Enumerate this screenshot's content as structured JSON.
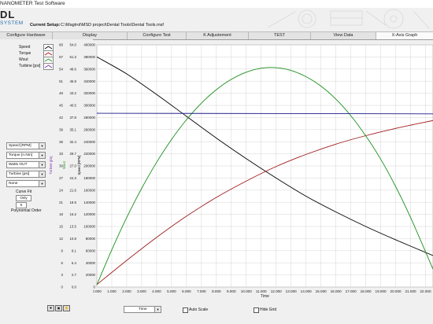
{
  "window": {
    "title": "NANOMETER Test Software"
  },
  "logo": {
    "mark": "DL",
    "subtitle": "SYSTEM"
  },
  "setup": {
    "label": "Current Setup:",
    "value": "C:\\Magtrol\\MSD project\\Dental Tools\\Dental Tools.msf"
  },
  "tabs": [
    {
      "label": "Configure Hardware"
    },
    {
      "label": "Display"
    },
    {
      "label": "Configure Test"
    },
    {
      "label": "K Adjustement"
    },
    {
      "label": "TEST"
    },
    {
      "label": "View Data"
    },
    {
      "label": "X-Axis Graph",
      "active": true
    }
  ],
  "legend": [
    {
      "label": "Speed",
      "color": "#000000"
    },
    {
      "label": "Torque",
      "color": "#c00000"
    },
    {
      "label": "Wout",
      "color": "#1a8f1a"
    },
    {
      "label": "Turbine [psi]",
      "color": "#7a2ca8"
    }
  ],
  "selectors": [
    {
      "value": "Speed [RPM]"
    },
    {
      "value": "Torque [n.Nm]"
    },
    {
      "value": "Watts OUT"
    },
    {
      "value": "Turbine [psi]"
    },
    {
      "value": "None"
    }
  ],
  "curve_fit": {
    "label": "Curve Fit",
    "mode": "Only",
    "order": "5",
    "order_label": "Polynomial Order"
  },
  "bottom": {
    "x_axis_select": "Time",
    "auto_scale_label": "Auto Scale",
    "hide_grid_label": "Hide Grid"
  },
  "chart_data": {
    "type": "line",
    "xlabel": "Time",
    "x_ticks": [
      "0.000",
      "1.000",
      "2.000",
      "3.000",
      "4.000",
      "5.000",
      "6.000",
      "7.000",
      "8.000",
      "9.000",
      "10.000",
      "11.000",
      "12.000",
      "13.000",
      "14.000",
      "15.000",
      "16.000",
      "17.000",
      "18.000",
      "19.000",
      "20.000",
      "21.000",
      "22.000"
    ],
    "xlim": [
      0,
      22.5
    ],
    "axes": [
      {
        "label": "Turbine [psi]",
        "color": "#7a2ca8",
        "ticks": [
          "0",
          "3",
          "6",
          "9",
          "12",
          "15",
          "18",
          "21",
          "24",
          "27",
          "30",
          "33",
          "36",
          "39",
          "42",
          "45",
          "48",
          "51",
          "54",
          "57",
          "60"
        ]
      },
      {
        "label": "Wout",
        "color": "#1a8f1a",
        "ticks": [
          "0.0",
          "2.7",
          "5.4",
          "8.1",
          "10.8",
          "13.5",
          "16.2",
          "18.9",
          "21.6",
          "24.3",
          "27.0",
          "29.7",
          "32.4",
          "35.1",
          "37.8",
          "40.5",
          "43.2",
          "45.9",
          "48.6",
          "51.3",
          "54.0"
        ],
        "ylim": [
          0,
          54
        ]
      },
      {
        "label": "Speed [RPM]",
        "color": "#000000",
        "ticks": [
          "0",
          "20000",
          "40000",
          "60000",
          "80000",
          "100000",
          "120000",
          "140000",
          "160000",
          "180000",
          "200000",
          "220000",
          "240000",
          "260000",
          "280000",
          "300000",
          "320000",
          "340000",
          "360000",
          "380000",
          "400000"
        ],
        "ylim": [
          0,
          400000
        ]
      }
    ],
    "series": [
      {
        "name": "Speed",
        "color": "#000000",
        "axis": 2,
        "x": [
          0,
          2,
          4,
          6,
          8,
          10,
          12,
          14,
          16,
          18,
          20,
          22.5
        ],
        "y": [
          380000,
          352000,
          318000,
          282000,
          246000,
          212000,
          180000,
          150000,
          124000,
          100000,
          78000,
          52000
        ]
      },
      {
        "name": "Torque",
        "color": "#a01c1c",
        "axis": 2,
        "x": [
          0,
          2,
          4,
          6,
          8,
          10,
          12,
          14,
          16,
          18,
          20,
          22.5
        ],
        "y": [
          4000,
          44000,
          82000,
          117000,
          148000,
          175000,
          199000,
          219000,
          236000,
          250000,
          262000,
          275000
        ]
      },
      {
        "name": "Wout",
        "color": "#1a8f1a",
        "axis": 1,
        "x": [
          0,
          1,
          2,
          3,
          4,
          5,
          6,
          7,
          8,
          9,
          10,
          11,
          12,
          13,
          14,
          15,
          16,
          17,
          18,
          19,
          20,
          21,
          22.5
        ],
        "y": [
          0.5,
          8.3,
          15.5,
          22.0,
          27.8,
          32.9,
          37.3,
          41.0,
          44.0,
          46.3,
          47.9,
          48.8,
          48.9,
          48.3,
          46.9,
          44.8,
          41.9,
          38.2,
          33.7,
          28.5,
          22.4,
          15.5,
          4.0
        ]
      },
      {
        "name": "Turbine",
        "color": "#1c1c8a",
        "axis": 2,
        "x": [
          0,
          22.5
        ],
        "y": [
          287000,
          286000
        ]
      }
    ]
  }
}
